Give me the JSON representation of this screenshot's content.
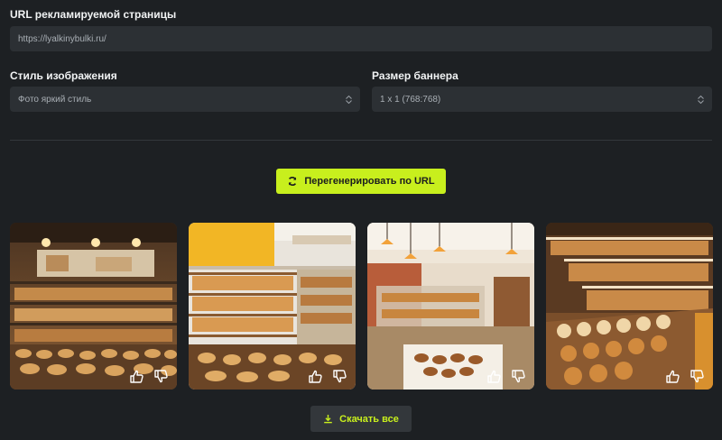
{
  "url_section": {
    "label": "URL рекламируемой страницы",
    "value": "https://lyalkinybulki.ru/"
  },
  "style_section": {
    "label": "Стиль изображения",
    "selected": "Фото яркий стиль"
  },
  "size_section": {
    "label": "Размер баннера",
    "selected": "1 x 1 (768:768)"
  },
  "actions": {
    "regenerate_label": "Перегенерировать по URL",
    "download_all_label": "Скачать все"
  },
  "gallery": {
    "images": [
      {
        "subject": "bakery interior with pastry display counters"
      },
      {
        "subject": "bakery shop with bread shelves and yellow sign"
      },
      {
        "subject": "bakery interior with hanging lamps and pastry cases"
      },
      {
        "subject": "bakery glass display cases with pastries"
      }
    ],
    "icons": {
      "like": "thumbs-up-icon",
      "dislike": "thumbs-down-icon"
    }
  },
  "colors": {
    "background": "#1d2023",
    "field": "#2c3034",
    "accent": "#c8ef1d",
    "secondary_button": "#33373b"
  }
}
